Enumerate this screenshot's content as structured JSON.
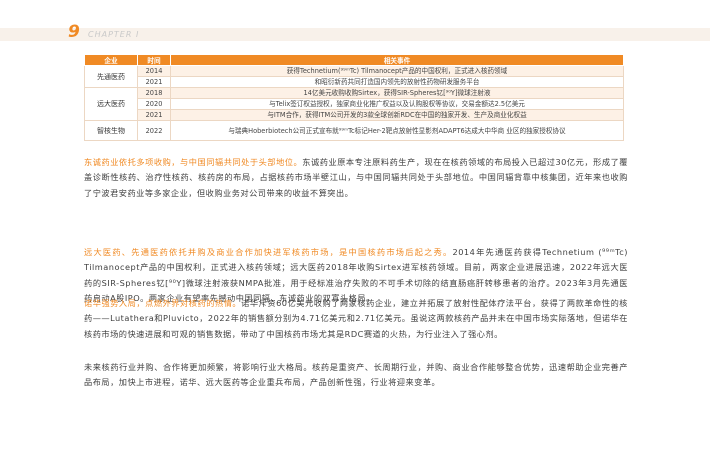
{
  "header": {
    "page_number": "9",
    "chapter": "CHAPTER I"
  },
  "table": {
    "columns": [
      "企业",
      "时间",
      "相关事件"
    ],
    "groups": [
      {
        "company": "先通医药",
        "rows": [
          {
            "year": "2014",
            "event": "获得Technetium(⁹⁹ᵐTc) Tilmanocept产品的中国权利，正式进入核药领域"
          },
          {
            "year": "2021",
            "event": "和昭衍新药共同打造国内领先的放射性药物研发服务平台"
          }
        ]
      },
      {
        "company": "远大医药",
        "rows": [
          {
            "year": "2018",
            "event": "14亿美元收购收购Sirtex，获得SIR-Spheres钇[⁹⁰Y]微球注射液"
          },
          {
            "year": "2020",
            "event": "与Telix签订权益授权，独家商业化推广权益以及认购股权等协议，交易金额达2.5亿美元"
          },
          {
            "year": "2021",
            "event": "与ITM合作，获得ITM公司开发的3款全球创新RDC在中国的独家开发、生产及商业化权益"
          }
        ]
      },
      {
        "company": "智核生物",
        "rows": [
          {
            "year": "2022",
            "event": "与瑞典Hoberbiotech公司正式宣布就⁹⁹ᵐTc标记Her-2靶点放射性显影剂ADAPT6达成大中华商 业区的独家授权协议"
          }
        ]
      }
    ]
  },
  "paragraphs": [
    {
      "highlight": "东诚药业依托多项收购，与中国同辐共同处于头部地位。",
      "body": "东诚药业原本专注原料药生产，现在在核药领域的布局投入已超过30亿元，形成了覆盖诊断性核药、治疗性核药、核药房的布局，占据核药市场半壁江山，与中国同辐共同处于头部地位。中国同辐背靠中核集团，近年来也收购了宁波君安药业等多家企业，但收购业务对公司带来的收益不算突出。"
    },
    {
      "highlight": "远大医药、先通医药依托并购及商业合作加快进军核药市场，是中国核药市场后起之秀。",
      "body": "2014年先通医药获得Technetium (⁹⁹ᵐTc) Tilmanocept产品的中国权利，正式进入核药领域；远大医药2018年收购Sirtex进军核药领域。目前，两家企业进展迅速，2022年远大医药的SIR-Spheres钇[⁹⁰Y]微球注射液获NMPA批准，用于经标准治疗失败的不可手术切除的结直肠癌肝转移患者的治疗。2023年3月先通医药启动A股IPO。两家企业有望率先撼动中国同辐、东诚药业的双寡头格局。"
    },
    {
      "highlight": "诺华强势入局，点燃外界对核药的热情。",
      "body": "诺华斥资60亿美元收购了两家核药企业，建立并拓展了放射性配体疗法平台，获得了两款革命性的核药——Lutathera和Pluvicto，2022年的销售额分别为4.71亿美元和2.71亿美元。虽说这两款核药产品并未在中国市场实际落地，但诺华在核药市场的快速进展和可观的销售数据，带动了中国核药市场尤其是RDC赛道的火热，为行业注入了强心剂。"
    },
    {
      "highlight": "",
      "body": "未来核药行业并购、合作将更加频繁，将影响行业大格局。核药是重资产、长周期行业，并购、商业合作能够整合优势，迅速帮助企业完善产品布局，加快上市进程，诺华、远大医药等企业重兵布局，产品创新性强，行业将迎来变革。"
    }
  ]
}
